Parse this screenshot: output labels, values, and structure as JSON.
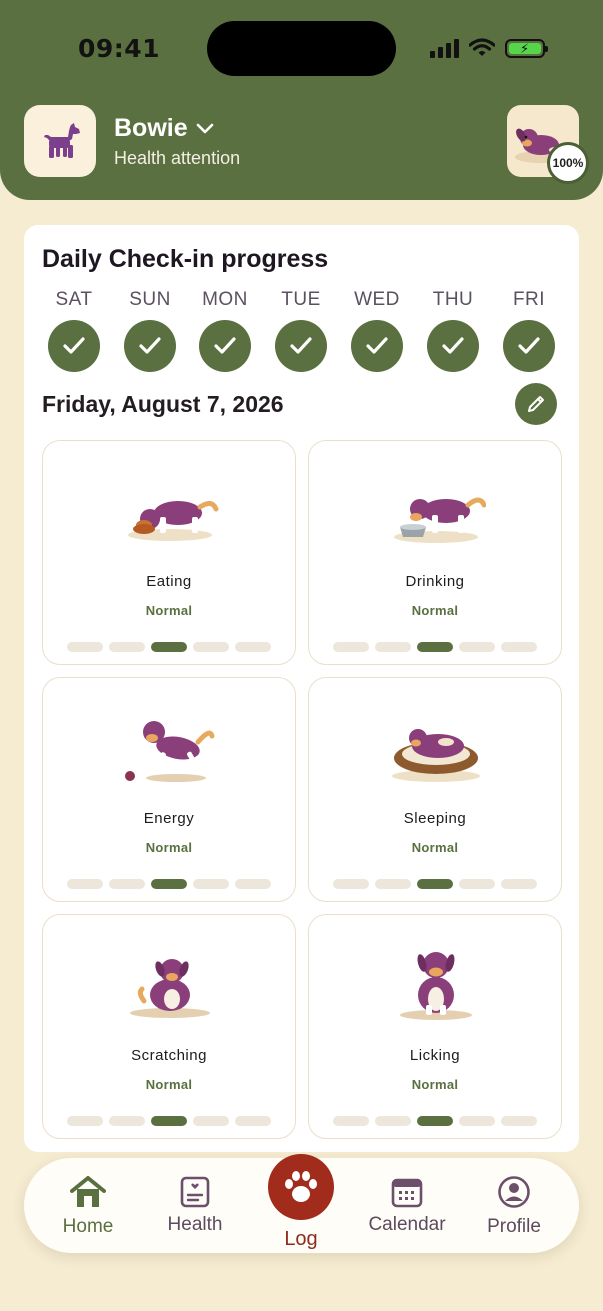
{
  "status_bar": {
    "time": "09:41"
  },
  "pet": {
    "name": "Bowie",
    "status": "Health attention",
    "completion": "100%"
  },
  "checkin": {
    "title": "Daily Check-in progress",
    "days": [
      {
        "label": "SAT",
        "done": true
      },
      {
        "label": "SUN",
        "done": true
      },
      {
        "label": "MON",
        "done": true
      },
      {
        "label": "TUE",
        "done": true
      },
      {
        "label": "WED",
        "done": true
      },
      {
        "label": "THU",
        "done": true
      },
      {
        "label": "FRI",
        "done": true
      }
    ],
    "date": "Friday, August 7, 2026"
  },
  "categories": [
    {
      "name": "Eating",
      "status": "Normal",
      "level": 3,
      "of": 5
    },
    {
      "name": "Drinking",
      "status": "Normal",
      "level": 3,
      "of": 5
    },
    {
      "name": "Energy",
      "status": "Normal",
      "level": 3,
      "of": 5
    },
    {
      "name": "Sleeping",
      "status": "Normal",
      "level": 3,
      "of": 5
    },
    {
      "name": "Scratching",
      "status": "Normal",
      "level": 3,
      "of": 5
    },
    {
      "name": "Licking",
      "status": "Normal",
      "level": 3,
      "of": 5
    }
  ],
  "nav": {
    "home": "Home",
    "health": "Health",
    "log": "Log",
    "calendar": "Calendar",
    "profile": "Profile"
  },
  "colors": {
    "header": "#5a7040",
    "accent": "#5a7040",
    "log_button": "#a22c1c",
    "background": "#f6ecd1"
  }
}
